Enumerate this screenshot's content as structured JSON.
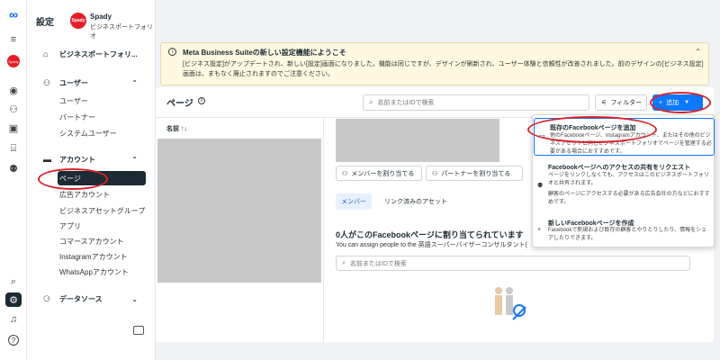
{
  "rail": {
    "logo": "∞",
    "avatar_text": "Spady",
    "icons": [
      "menu-icon",
      "home-icon",
      "people-icon",
      "pages-icon",
      "store-icon",
      "people-group-icon",
      "search-icon",
      "gear-icon",
      "bell-icon",
      "help-icon"
    ]
  },
  "nav": {
    "title": "設定",
    "business": {
      "avatar": "Spady",
      "name": "Spady",
      "sub": "ビジネスポートフォリオ"
    },
    "portfolio_label": "ビジネスポートフォリ...",
    "users": {
      "label": "ユーザー",
      "items": [
        "ユーザー",
        "パートナー",
        "システムユーザー"
      ]
    },
    "accounts": {
      "label": "アカウント",
      "items": [
        "ページ",
        "広告アカウント",
        "ビジネスアセットグループ",
        "アプリ",
        "コマースアカウント",
        "Instagramアカウント",
        "WhatsAppアカウント"
      ]
    },
    "datasources": {
      "label": "データソース"
    }
  },
  "banner": {
    "title": "Meta Business Suiteの新しい設定機能にようこそ",
    "body": "[ビジネス設定]がアップデートされ、新しい[設定]画面になりました。機能は同じですが、デザインが刷新され、ユーザー体験と信頼性が改善されました。前のデザインの[ビジネス設定]画面は、まもなく廃止されますのでご注意ください。"
  },
  "panel": {
    "title": "ページ",
    "search_placeholder": "名前またはIDで検索",
    "filter_label": "フィルター",
    "add_label": "追加",
    "column_name": "名前 ↑↓",
    "assign_people_button": "メンバーを割り当てる",
    "assign_partner_button": "パートナーを割り当てる",
    "tabs": [
      "メンバー",
      "リンク済みのアセット"
    ],
    "empty_title": "0人がこのFacebookページに割り当てられています",
    "empty_sub": "You can assign people to the 英語スーパーバイザーコンサルタント(",
    "search2_placeholder": "名前またはIDで検索"
  },
  "dropdown": {
    "options": [
      {
        "title": "既存のFacebookページを追加",
        "desc": "他のFacebookページ、Instagramアカウント、またはその他のビジネスアセットと同じビジネスポートフォリオでページを管理する必要がある場合におすすめです。"
      },
      {
        "title": "Facebookページへのアクセスの共有をリクエスト",
        "desc": "ページをリンクしなくても、アクセスはこのビジネスポートフォリオと共有されます。",
        "desc2": "顧客のページにアクセスする必要がある広告会社の方などにおすすめです。"
      },
      {
        "title": "新しいFacebookページを作成",
        "desc": "Facebookで新規および既存の顧客とやりとりしたり、情報をシェアしたりできます。"
      }
    ]
  },
  "colors": {
    "accent": "#0a78ff",
    "annotation": "#d8232a",
    "brand": "#e41e26"
  }
}
